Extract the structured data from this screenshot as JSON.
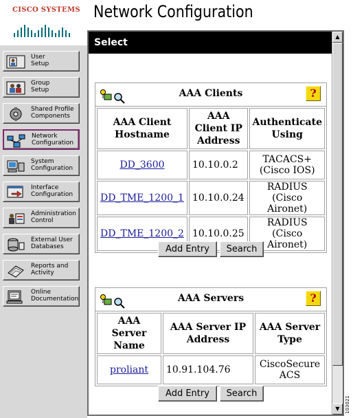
{
  "logo": {
    "brand": "Cisco Systems"
  },
  "title": "Network Configuration",
  "nav": [
    {
      "label": "User\nSetup",
      "icon": "user-icon"
    },
    {
      "label": "Group\nSetup",
      "icon": "group-icon"
    },
    {
      "label": "Shared Profile\nComponents",
      "icon": "shared-profile-icon"
    },
    {
      "label": "Network\nConfiguration",
      "icon": "network-icon",
      "active": true
    },
    {
      "label": "System\nConfiguration",
      "icon": "system-icon"
    },
    {
      "label": "Interface\nConfiguration",
      "icon": "interface-icon"
    },
    {
      "label": "Administration\nControl",
      "icon": "administration-icon"
    },
    {
      "label": "External User\nDatabases",
      "icon": "database-icon"
    },
    {
      "label": "Reports and\nActivity",
      "icon": "reports-icon"
    },
    {
      "label": "Online\nDocumentation",
      "icon": "documentation-icon"
    }
  ],
  "main": {
    "header": "Select",
    "aaa_clients": {
      "title": "AAA Clients",
      "help": "?",
      "columns": [
        "AAA Client Hostname",
        "AAA Client IP Address",
        "Authenticate Using"
      ],
      "rows": [
        {
          "hostname": "DD_3600",
          "ip": "10.10.0.2",
          "auth": "TACACS+ (Cisco IOS)"
        },
        {
          "hostname": "DD_TME_1200_1",
          "ip": "10.10.0.24",
          "auth": "RADIUS (Cisco Aironet)"
        },
        {
          "hostname": "DD_TME_1200_2",
          "ip": "10.10.0.25",
          "auth": "RADIUS (Cisco Aironet)"
        }
      ],
      "add_entry": "Add Entry",
      "search": "Search"
    },
    "aaa_servers": {
      "title": "AAA Servers",
      "help": "?",
      "columns": [
        "AAA Server Name",
        "AAA Server IP Address",
        "AAA Server Type"
      ],
      "rows": [
        {
          "name": "proliant",
          "ip": "10.91.104.76",
          "type": "CiscoSecure ACS"
        }
      ],
      "add_entry": "Add Entry",
      "search": "Search"
    }
  },
  "figure_id": "103021",
  "colors": {
    "header_bg": "#000000",
    "help_bg": "#f4d80f",
    "link": "#1a1a9c",
    "active_border": "#7a2a6e",
    "logo_red": "#c0392b"
  }
}
